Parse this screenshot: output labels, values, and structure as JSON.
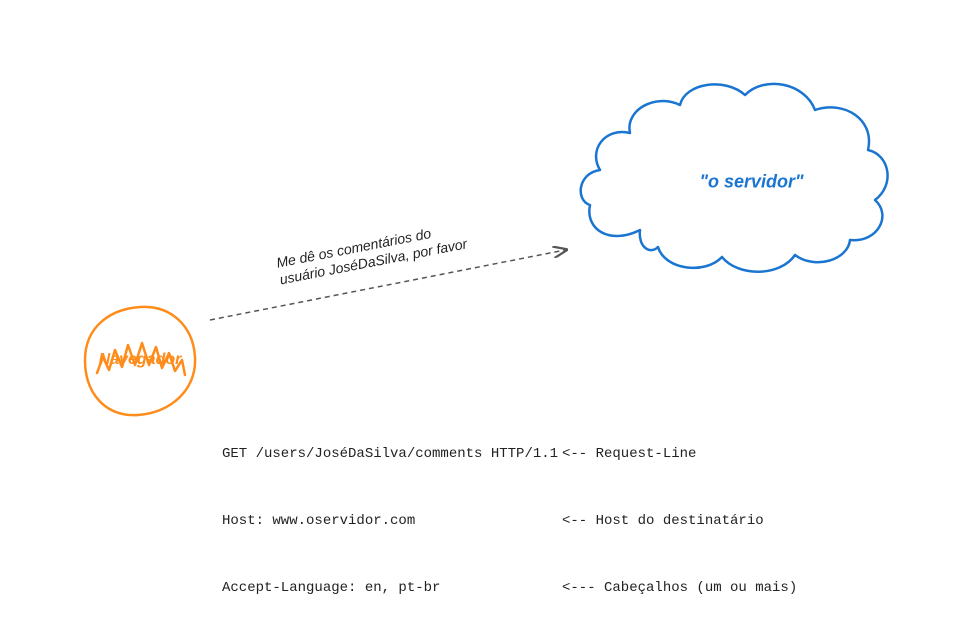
{
  "browser": {
    "label": "Navegador"
  },
  "server": {
    "label": "\"o servidor\""
  },
  "request_caption": {
    "line1": "Me dê os comentários do",
    "line2": "usuário JoséDaSilva, por favor"
  },
  "http": {
    "row1_left": "GET /users/JoséDaSilva/comments HTTP/1.1",
    "row1_right": "<-- Request-Line",
    "row2_left": "Host: www.oservidor.com",
    "row2_right": "<-- Host do destinatário",
    "row3_left": "Accept-Language: en, pt-br",
    "row3_right": "<--- Cabeçalhos (um ou mais)"
  },
  "colors": {
    "orange": "#ff8c1a",
    "blue": "#1a75d1",
    "text": "#222222"
  }
}
